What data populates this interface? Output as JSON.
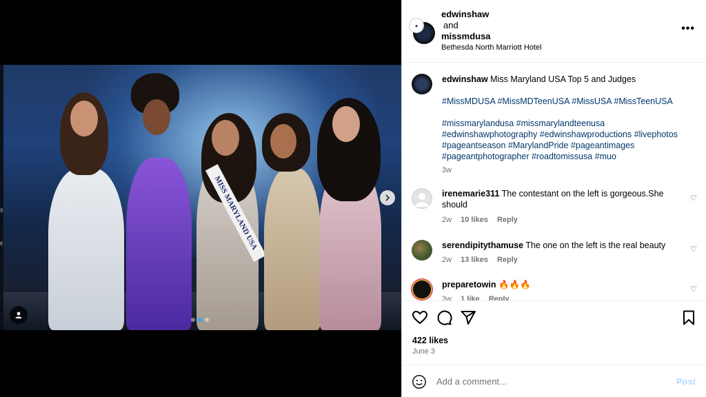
{
  "media": {
    "side_text": "s e",
    "sash_text": "MISS MARYLAND USA",
    "next_icon": "chevron-right-icon",
    "user_tag_icon": "person-icon",
    "carousel": {
      "count": 3,
      "active": 1
    }
  },
  "header": {
    "user1": "edwinshaw",
    "and": "and",
    "user2": "missmdusa",
    "location": "Bethesda North Marriott Hotel",
    "more_icon": "more-horizontal-icon"
  },
  "caption": {
    "username": "edwinshaw",
    "text": "Miss Maryland USA Top 5 and Judges",
    "tags1": "#MissMDUSA #MissMDTeenUSA #MissUSA #MissTeenUSA",
    "tags2": "#missmarylandusa #missmarylandteenusa #edwinshawphotography #edwinshawproductions #livephotos #pageantseason #MarylandPride #pageantimages #pageantphotographer #roadtomissusa #muo",
    "time": "3w"
  },
  "comments": [
    {
      "username": "irenemarie311",
      "text": "The contestant on the left is gorgeous.She should",
      "time": "2w",
      "likes": "10 likes",
      "reply": "Reply"
    },
    {
      "username": "serendipitythamuse",
      "text": "The one on the left is the real beauty",
      "time": "2w",
      "likes": "13 likes",
      "reply": "Reply"
    },
    {
      "username": "preparetowin",
      "text": "🔥🔥🔥",
      "time": "3w",
      "likes": "1 like",
      "reply": "Reply"
    }
  ],
  "actions": {
    "likes": "422 likes",
    "date": "June 3",
    "icons": [
      "heart-icon",
      "comment-icon",
      "share-icon",
      "bookmark-icon"
    ]
  },
  "add_comment": {
    "placeholder": "Add a comment...",
    "post": "Post"
  },
  "colors": {
    "link": "#00376b",
    "muted": "#737373",
    "post": "#b3dbff",
    "carousel_active": "#3ea2f7"
  }
}
